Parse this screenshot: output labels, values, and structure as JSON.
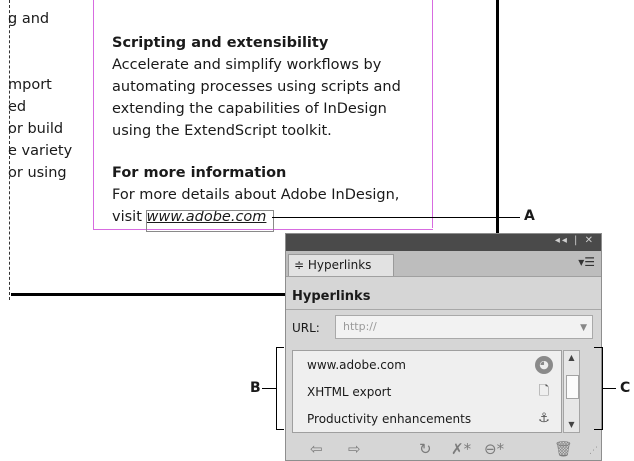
{
  "document": {
    "left_column": [
      "g and",
      "",
      "",
      "mport",
      "ed",
      "or build",
      "e variety",
      " or using"
    ],
    "section1_heading": "Scripting and extensibility",
    "section1_body": [
      "Accelerate and simplify workflows by",
      "automating processes using scripts and",
      "extending the capabilities of InDesign",
      "using the ExtendScript toolkit."
    ],
    "section2_heading": "For more information",
    "section2_line1": "For more details about Adobe InDesign,",
    "section2_visit": "visit ",
    "section2_url": "www.adobe.com"
  },
  "callouts": {
    "a": "A",
    "b": "B",
    "c": "C"
  },
  "panel": {
    "title_controls": "◂◂ | ✕",
    "tab_label": "≑ Hyperlinks",
    "menu_icon": "▾☰",
    "heading": "Hyperlinks",
    "url_label": "URL:",
    "url_value": "http://",
    "items": [
      {
        "label": "www.adobe.com",
        "icon": "globe-icon"
      },
      {
        "label": "XHTML export",
        "icon": "page-icon"
      },
      {
        "label": "Productivity enhancements",
        "icon": "anchor-icon"
      }
    ],
    "toolbar_icons": [
      "prev-arrow-icon",
      "next-arrow-icon",
      "refresh-icon",
      "delete-link-icon",
      "chain-icon",
      "trash-icon"
    ]
  },
  "colors": {
    "frame": "#d76be0",
    "panel_bg": "#d6d6d6",
    "title_bar": "#4a4a4a"
  }
}
